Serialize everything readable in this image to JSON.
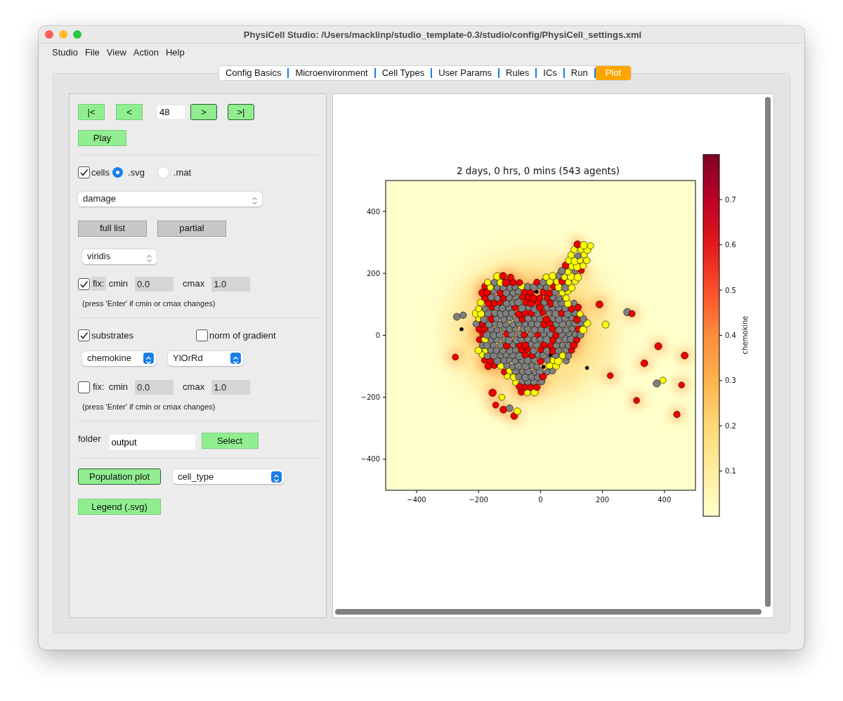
{
  "window": {
    "title": "PhysiCell Studio: /Users/macklinp/studio_template-0.3/studio/config/PhysiCell_settings.xml"
  },
  "menu": [
    "Studio",
    "File",
    "View",
    "Action",
    "Help"
  ],
  "tabs": [
    {
      "label": "Config Basics",
      "selected": false
    },
    {
      "label": "Microenvironment",
      "selected": false
    },
    {
      "label": "Cell Types",
      "selected": false
    },
    {
      "label": "User Params",
      "selected": false
    },
    {
      "label": "Rules",
      "selected": false
    },
    {
      "label": "ICs",
      "selected": false
    },
    {
      "label": "Run",
      "selected": false
    },
    {
      "label": "Plot",
      "selected": true
    }
  ],
  "playback": {
    "controls": [
      {
        "kind": "button",
        "label": "|<",
        "outlined": false
      },
      {
        "kind": "button",
        "label": "<",
        "outlined": false
      },
      {
        "kind": "field",
        "value": "48"
      },
      {
        "kind": "button",
        "label": ">",
        "outlined": true
      },
      {
        "kind": "button",
        "label": ">|",
        "outlined": true
      }
    ],
    "play_button": "Play"
  },
  "cells": {
    "label": "cells",
    "checked": true,
    "formats": [
      {
        "label": ".svg",
        "selected": true
      },
      {
        "label": ".mat",
        "selected": false
      }
    ],
    "variable": {
      "value": "damage",
      "active": false
    },
    "buttons": [
      "full list",
      "partial"
    ],
    "colormap": {
      "value": "viridis",
      "active": false
    },
    "fix": {
      "label": "fix:",
      "checked": true,
      "cmin_label": "cmin",
      "cmin": "0.0",
      "cmax_label": "cmax",
      "cmax": "1.0"
    },
    "note": "(press 'Enter' if cmin or cmax changes)"
  },
  "substrates": {
    "label": "substrates",
    "checked": true,
    "gradient": {
      "label": "norm of gradient",
      "checked": false
    },
    "substrate": {
      "value": "chemokine",
      "active": true
    },
    "colormap": {
      "value": "YlOrRd",
      "active": true
    },
    "fix": {
      "label": "fix:",
      "checked": false,
      "cmin_label": "cmin",
      "cmin": "0.0",
      "cmax_label": "cmax",
      "cmax": "1.0"
    },
    "note": "(press 'Enter' if cmin or cmax changes)"
  },
  "folder": {
    "label": "folder",
    "value": "output",
    "button": "Select"
  },
  "population": {
    "button": "Population plot",
    "field": {
      "value": "cell_type",
      "active": true
    },
    "legend_button": "Legend (.svg)"
  },
  "plot": {
    "title": "2 days, 0 hrs, 0 mins (543 agents)",
    "xticks": [
      "−400",
      "−200",
      "0",
      "200",
      "400"
    ],
    "yticks": [
      "400",
      "200",
      "0",
      "−200",
      "−400"
    ],
    "colorbar": {
      "label": "chemokine",
      "ticks": [
        "0.7",
        "0.6",
        "0.5",
        "0.4",
        "0.3",
        "0.2",
        "0.1"
      ]
    }
  }
}
